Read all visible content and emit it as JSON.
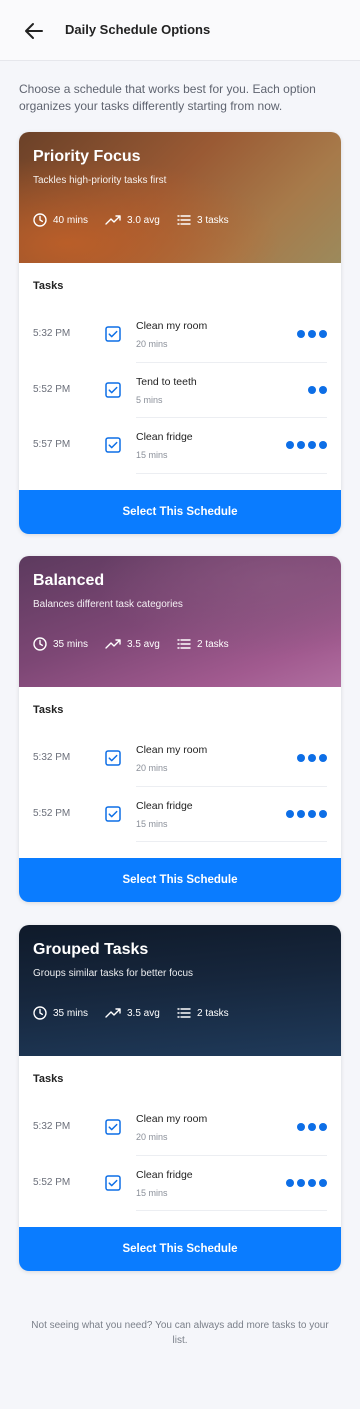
{
  "header": {
    "title": "Daily Schedule Options",
    "back_icon": "arrow-left-icon"
  },
  "intro": "Choose a schedule that works best for you. Each option organizes your tasks differently starting from now.",
  "colors": {
    "accent": "#0a7cff",
    "dots": "#0d6ee6"
  },
  "cards": [
    {
      "title": "Priority Focus",
      "subtitle": "Tackles high-priority tasks first",
      "duration": "40 mins",
      "avg": "3.0 avg",
      "count": "3 tasks",
      "tasks_label": "Tasks",
      "button": "Select This Schedule",
      "tasks": [
        {
          "time": "5:32 PM",
          "name": "Clean my room",
          "duration": "20 mins",
          "priority": 3,
          "checked": true
        },
        {
          "time": "5:52 PM",
          "name": "Tend to teeth",
          "duration": "5 mins",
          "priority": 2,
          "checked": true
        },
        {
          "time": "5:57 PM",
          "name": "Clean fridge",
          "duration": "15 mins",
          "priority": 4,
          "checked": true
        }
      ]
    },
    {
      "title": "Balanced",
      "subtitle": "Balances different task categories",
      "duration": "35 mins",
      "avg": "3.5 avg",
      "count": "2 tasks",
      "tasks_label": "Tasks",
      "button": "Select This Schedule",
      "tasks": [
        {
          "time": "5:32 PM",
          "name": "Clean my room",
          "duration": "20 mins",
          "priority": 3,
          "checked": true
        },
        {
          "time": "5:52 PM",
          "name": "Clean fridge",
          "duration": "15 mins",
          "priority": 4,
          "checked": true
        }
      ]
    },
    {
      "title": "Grouped Tasks",
      "subtitle": "Groups similar tasks for better focus",
      "duration": "35 mins",
      "avg": "3.5 avg",
      "count": "2 tasks",
      "tasks_label": "Tasks",
      "button": "Select This Schedule",
      "tasks": [
        {
          "time": "5:32 PM",
          "name": "Clean my room",
          "duration": "20 mins",
          "priority": 3,
          "checked": true
        },
        {
          "time": "5:52 PM",
          "name": "Clean fridge",
          "duration": "15 mins",
          "priority": 4,
          "checked": true
        }
      ]
    }
  ],
  "footer": "Not seeing what you need? You can always add more tasks to your list."
}
